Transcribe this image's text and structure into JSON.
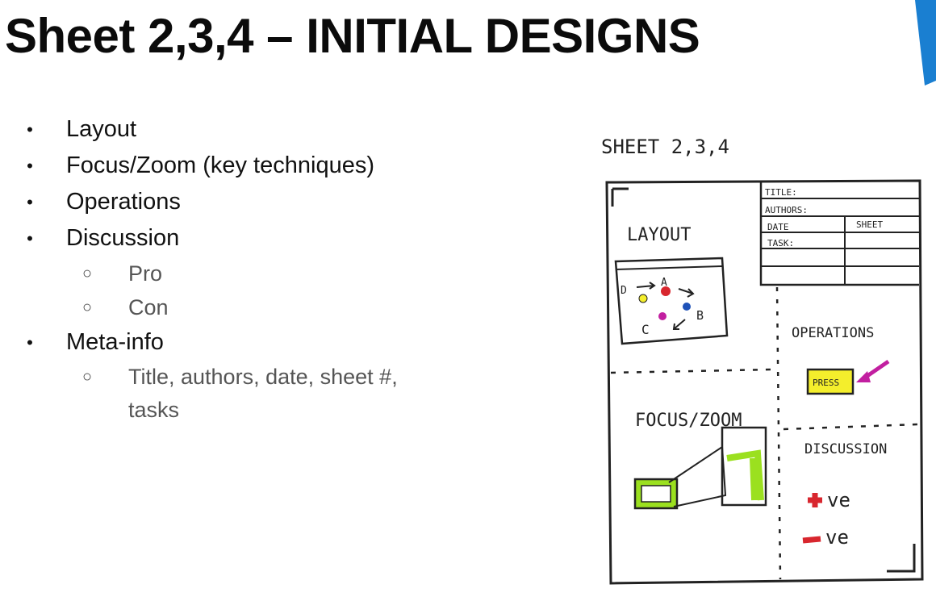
{
  "slide": {
    "title": "Sheet 2,3,4 – INITIAL DESIGNS",
    "accent_color": "#1a7fd1"
  },
  "bullets": [
    {
      "label": "Layout"
    },
    {
      "label": "Focus/Zoom (key techniques)"
    },
    {
      "label": "Operations"
    },
    {
      "label": "Discussion",
      "children": [
        "Pro",
        "Con"
      ]
    },
    {
      "label": "Meta-info",
      "children": [
        "Title, authors, date, sheet #, tasks"
      ]
    }
  ],
  "bullet_glyphs": {
    "level1": "•",
    "level2": "○"
  },
  "sketch": {
    "header": "SHEET 2,3,4",
    "meta_title": "TITLE:",
    "meta_authors": "AUTHORS:",
    "meta_date": "DATE",
    "meta_sheet": "SHEET",
    "meta_task": "TASK:",
    "layout_label": "LAYOUT",
    "operations_label": "OPERATIONS",
    "press_label": "PRESS",
    "focus_label": "FOCUS/ZOOM",
    "discussion_label": "DISCUSSION",
    "node_a": "A",
    "node_b": "B",
    "node_c": "C",
    "node_d": "D",
    "pro_label": "ve",
    "con_label": "ve",
    "colors": {
      "ink": "#222222",
      "green": "#9be01f",
      "yellow": "#f4ee2c",
      "magenta": "#c21fa0",
      "red": "#d8262e",
      "blue": "#1f52b8"
    }
  }
}
